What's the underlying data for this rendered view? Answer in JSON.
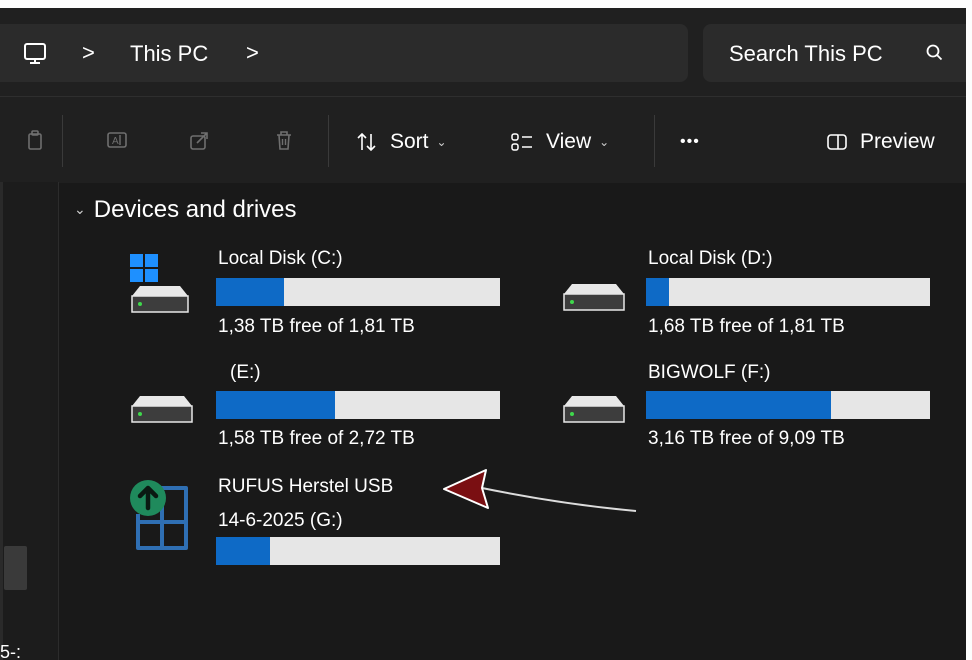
{
  "address_bar": {
    "icon": "computer-icon",
    "breadcrumb": "This PC",
    "chevron": ">",
    "search_placeholder": "Search This PC"
  },
  "command_bar": {
    "icons": [
      "copy-icon",
      "rename-icon",
      "share-icon",
      "delete-icon"
    ],
    "sort_label": "Sort",
    "view_label": "View",
    "more_label": "•••",
    "preview_label": "Preview"
  },
  "nav_pane": {
    "truncated_text": "5-:"
  },
  "section": {
    "title": "Devices and drives"
  },
  "drives": [
    {
      "name": "Local Disk (C:)",
      "free_text": "1,38 TB free of 1,81 TB",
      "used_fraction": 0.24,
      "icon": "windows-drive-icon"
    },
    {
      "name": "Local Disk (D:)",
      "free_text": "1,68 TB free of 1,81 TB",
      "used_fraction": 0.08,
      "icon": "hard-drive-icon"
    },
    {
      "name": "(E:)",
      "free_text": "1,58 TB free of 2,72 TB",
      "used_fraction": 0.42,
      "icon": "hard-drive-icon"
    },
    {
      "name": "BIGWOLF (F:)",
      "free_text": "3,16 TB free of 9,09 TB",
      "used_fraction": 0.65,
      "icon": "hard-drive-icon"
    },
    {
      "name": "RUFUS Herstel USB",
      "name_line2": "14-6-2025 (G:)",
      "used_fraction": 0.19,
      "icon": "usb-install-drive-icon"
    }
  ],
  "colors": {
    "bar_fill": "#0e6ac6",
    "bar_track": "#e6e6e6",
    "annotation_arrow": "#7a0f12",
    "background": "#191919"
  }
}
